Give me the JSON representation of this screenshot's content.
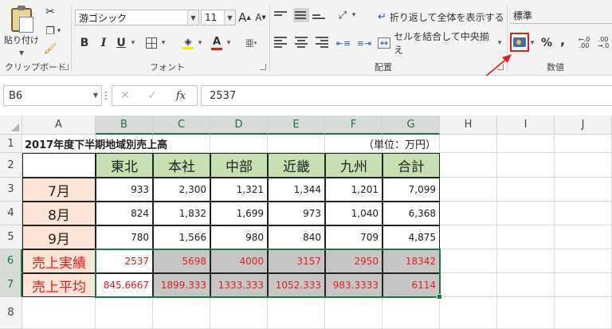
{
  "ribbon": {
    "clipboard": {
      "paste_label": "貼り付け",
      "group_label": "クリップボード"
    },
    "font": {
      "font_name": "游ゴシック",
      "font_size": "11",
      "bold": "B",
      "italic": "I",
      "underline": "U",
      "group_label": "フォント",
      "grow": "A",
      "shrink": "A"
    },
    "alignment": {
      "wrap_text": "折り返して全体を表示する",
      "merge_center": "セルを結合して中央揃え",
      "group_label": "配置"
    },
    "number": {
      "format": "標準",
      "percent": "%",
      "comma": ",",
      "inc_decimal": ".00",
      "dec_decimal": ".0",
      "group_label": "数値"
    }
  },
  "formula_bar": {
    "name_box": "B6",
    "value": "2537",
    "fx": "fx"
  },
  "columns": [
    "A",
    "B",
    "C",
    "D",
    "E",
    "F",
    "G",
    "H",
    "I",
    "J"
  ],
  "rows": [
    "1",
    "2",
    "3",
    "4",
    "5",
    "6",
    "7",
    "8"
  ],
  "sheet": {
    "title": "2017年度下半期地域別売上高",
    "unit": "（単位：万円）",
    "headers": [
      "東北",
      "本社",
      "中部",
      "近畿",
      "九州",
      "合計"
    ],
    "row_labels": [
      "7月",
      "8月",
      "9月",
      "売上実績",
      "売上平均"
    ],
    "values": [
      [
        "933",
        "2,300",
        "1,321",
        "1,344",
        "1,201",
        "7,099"
      ],
      [
        "824",
        "1,832",
        "1,699",
        "973",
        "1,040",
        "6,368"
      ],
      [
        "780",
        "1,566",
        "980",
        "840",
        "709",
        "4,875"
      ],
      [
        "2537",
        "5698",
        "4000",
        "3157",
        "2950",
        "18342"
      ],
      [
        "845.6667",
        "1899.333",
        "1333.333",
        "1052.333",
        "983.3333",
        "6114"
      ]
    ]
  },
  "colors": {
    "accent": "#217346",
    "highlight_red": "#e02020",
    "header_green": "#c6e0b4",
    "label_peach": "#fce4d6"
  }
}
